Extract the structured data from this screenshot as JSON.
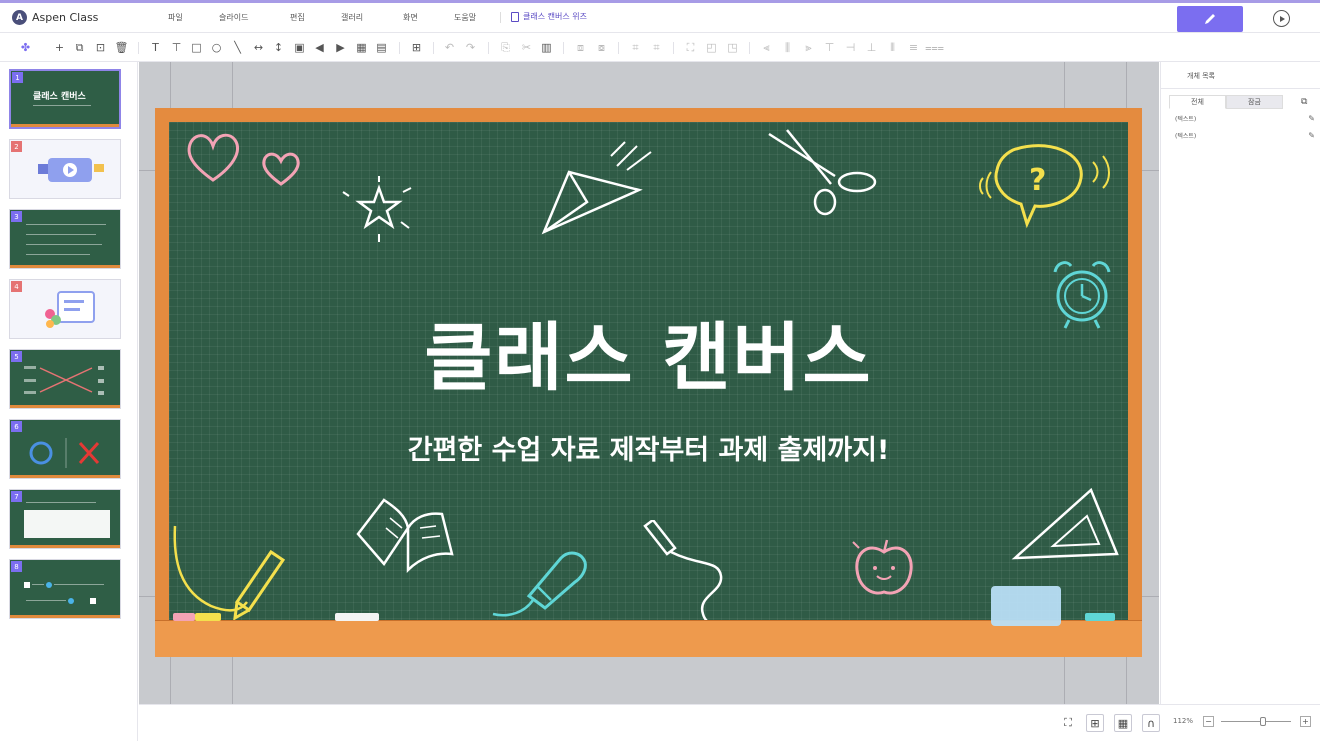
{
  "app": {
    "name": "Aspen Class",
    "document_title": "클래스 캔버스 위즈"
  },
  "menu": {
    "items": [
      "파일",
      "슬라이드",
      "편집",
      "갤러리",
      "화면",
      "도움말"
    ]
  },
  "colors": {
    "accent": "#7b6ef0",
    "board_green": "#2f5b46",
    "board_frame": "#e48b3f",
    "canvas_bg": "#c8cace"
  },
  "toolbar": {
    "icons": [
      "theme-icon",
      "add-slide-icon",
      "duplicate-slide-icon",
      "slide-settings-icon",
      "delete-slide-icon",
      "text-box-icon",
      "vertical-text-icon",
      "rectangle-icon",
      "circle-icon",
      "line-icon",
      "arrow-line-icon",
      "vertical-line-icon",
      "image-icon",
      "audio-icon",
      "video-icon",
      "table-icon",
      "embed-icon",
      "insert-icon",
      "undo-icon",
      "redo-icon",
      "copy-icon",
      "cut-icon",
      "paste-icon",
      "group-icon",
      "ungroup-icon",
      "crop-icon",
      "crop-reset-icon",
      "fit-icon",
      "bring-front-icon",
      "send-back-icon",
      "align-left-icon",
      "align-center-icon",
      "align-right-icon",
      "align-top-icon",
      "align-middle-icon",
      "align-bottom-icon",
      "distribute-h-icon",
      "distribute-v-icon"
    ]
  },
  "slides": [
    {
      "number": "1",
      "kind": "green",
      "selected": true,
      "label": "클래스 캔버스"
    },
    {
      "number": "2",
      "kind": "white",
      "selected": false
    },
    {
      "number": "3",
      "kind": "green",
      "selected": false
    },
    {
      "number": "4",
      "kind": "white",
      "selected": false
    },
    {
      "number": "5",
      "kind": "green",
      "selected": false
    },
    {
      "number": "6",
      "kind": "green",
      "selected": false
    },
    {
      "number": "7",
      "kind": "green",
      "selected": false
    },
    {
      "number": "8",
      "kind": "green",
      "selected": false
    }
  ],
  "slide": {
    "title": "클래스 캔버스",
    "subtitle": "간편한 수업 자료 제작부터 과제 출제까지!"
  },
  "object_panel": {
    "title": "개체 목록",
    "tabs": [
      "전체",
      "잠금"
    ],
    "rows": [
      "(텍스트)",
      "(텍스트)"
    ]
  },
  "statusbar": {
    "zoom": "112%"
  }
}
